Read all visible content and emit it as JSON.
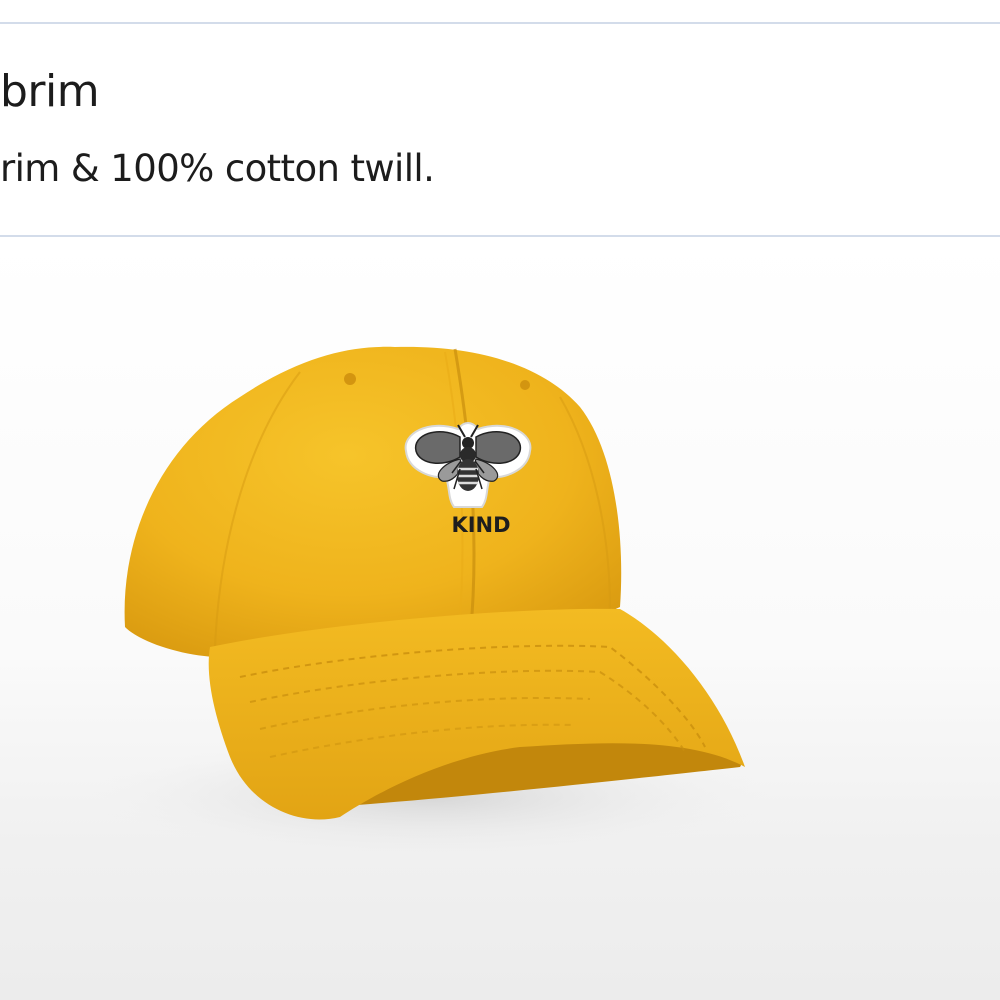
{
  "product": {
    "title": "brim",
    "description": "rim & 100% cotton twill."
  },
  "image": {
    "subject": "yellow-baseball-cap",
    "cap_color": "#f2b41c",
    "patch_text": "KIND",
    "patch_icon": "bee-icon"
  }
}
